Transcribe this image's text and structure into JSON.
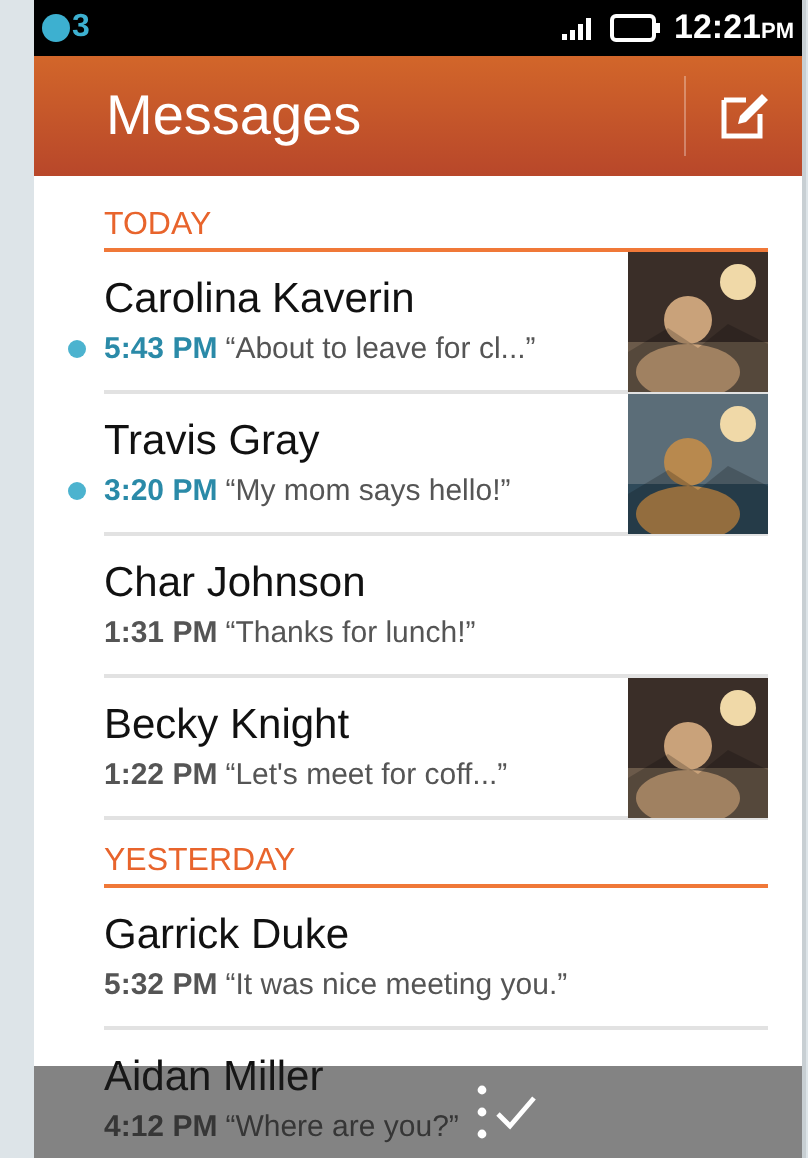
{
  "status_bar": {
    "notification_count": "3",
    "time": "12:21",
    "time_suffix": "PM"
  },
  "header": {
    "title": "Messages"
  },
  "sections": [
    {
      "label": "TODAY",
      "threads": [
        {
          "name": "Carolina Kaverin",
          "time": "5:43 PM",
          "preview": "“About to leave for cl...”",
          "unread": true
        },
        {
          "name": "Travis Gray",
          "time": "3:20 PM",
          "preview": "“My mom says hello!”",
          "unread": true
        },
        {
          "name": "Char Johnson",
          "time": "1:31 PM",
          "preview": "“Thanks for lunch!”",
          "unread": false
        },
        {
          "name": "Becky Knight",
          "time": "1:22 PM",
          "preview": "“Let's meet for coff...”",
          "unread": false
        }
      ]
    },
    {
      "label": "YESTERDAY",
      "threads": [
        {
          "name": "Garrick Duke",
          "time": "5:32 PM",
          "preview": "“It was nice meeting you.”",
          "unread": false
        },
        {
          "name": "Aidan Miller",
          "time": "4:12 PM",
          "preview": "“Where are you?”",
          "unread": false
        }
      ]
    }
  ]
}
